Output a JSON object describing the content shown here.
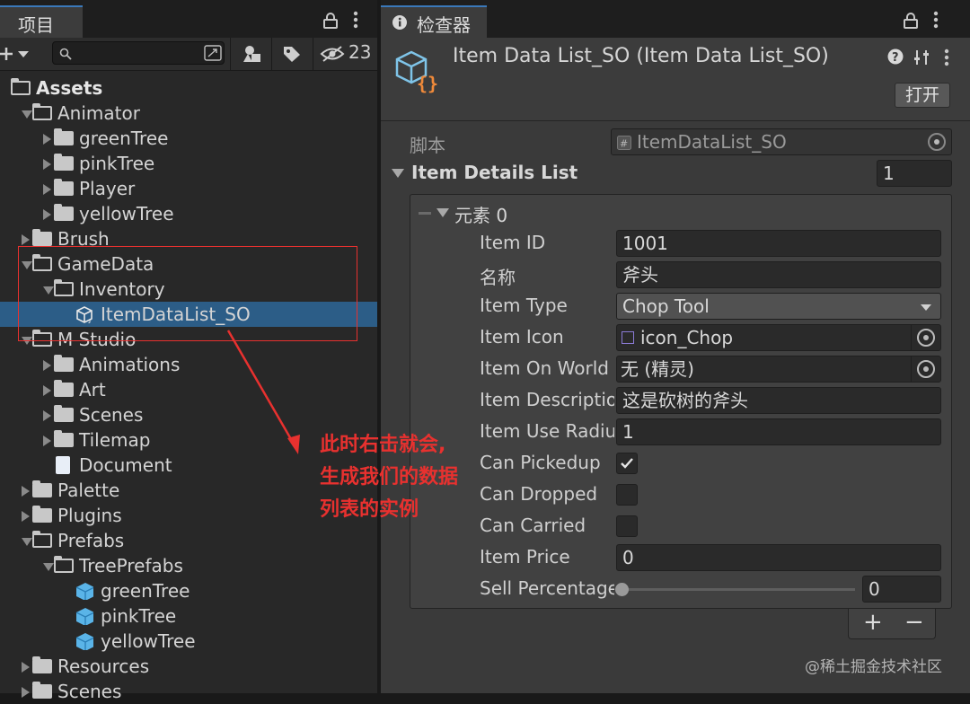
{
  "project_panel": {
    "tab_title": "项目",
    "search": {
      "value": "",
      "placeholder": ""
    },
    "hidden_count": "23",
    "assets_label": "Assets",
    "tree": [
      {
        "label": "Animator",
        "depth": 1,
        "expanded": true
      },
      {
        "label": "greenTree",
        "depth": 2,
        "expanded": false
      },
      {
        "label": "pinkTree",
        "depth": 2,
        "expanded": false
      },
      {
        "label": "Player",
        "depth": 2,
        "expanded": false
      },
      {
        "label": "yellowTree",
        "depth": 2,
        "expanded": false
      },
      {
        "label": "Brush",
        "depth": 1,
        "expanded": false
      },
      {
        "label": "GameData",
        "depth": 1,
        "expanded": true
      },
      {
        "label": "Inventory",
        "depth": 2,
        "expanded": true
      },
      {
        "label": "ItemDataList_SO",
        "depth": 3,
        "kind": "scriptable",
        "selected": true
      },
      {
        "label": "M Studio",
        "depth": 1,
        "expanded": true
      },
      {
        "label": "Animations",
        "depth": 2,
        "expanded": false
      },
      {
        "label": "Art",
        "depth": 2,
        "expanded": false
      },
      {
        "label": "Scenes",
        "depth": 2,
        "expanded": false
      },
      {
        "label": "Tilemap",
        "depth": 2,
        "expanded": false
      },
      {
        "label": "Document",
        "depth": 2,
        "kind": "document"
      },
      {
        "label": "Palette",
        "depth": 1,
        "expanded": false
      },
      {
        "label": "Plugins",
        "depth": 1,
        "expanded": false
      },
      {
        "label": "Prefabs",
        "depth": 1,
        "expanded": true
      },
      {
        "label": "TreePrefabs",
        "depth": 2,
        "expanded": true
      },
      {
        "label": "greenTree",
        "depth": 3,
        "kind": "prefab"
      },
      {
        "label": "pinkTree",
        "depth": 3,
        "kind": "prefab"
      },
      {
        "label": "yellowTree",
        "depth": 3,
        "kind": "prefab"
      },
      {
        "label": "Resources",
        "depth": 1,
        "expanded": false
      },
      {
        "label": "Scenes",
        "depth": 1,
        "expanded": false
      }
    ]
  },
  "inspector": {
    "tab_title": "检查器",
    "object_title": "Item Data List_SO (Item Data List_SO)",
    "open_button": "打开",
    "script_label": "脚本",
    "script_value": "ItemDataList_SO",
    "list_label": "Item Details List",
    "list_count": "1",
    "element_label": "元素 0",
    "fields": {
      "item_id": {
        "label": "Item ID",
        "value": "1001"
      },
      "name": {
        "label": "名称",
        "value": "斧头"
      },
      "item_type": {
        "label": "Item Type",
        "value": "Chop Tool"
      },
      "item_icon": {
        "label": "Item Icon",
        "value": "icon_Chop"
      },
      "item_on_world": {
        "label": "Item On World",
        "value": "无 (精灵)"
      },
      "item_description": {
        "label": "Item Description",
        "value": "这是砍树的斧头"
      },
      "item_use_radius": {
        "label": "Item Use Radius",
        "value": "1"
      },
      "can_pickedup": {
        "label": "Can Pickedup",
        "checked": true
      },
      "can_dropped": {
        "label": "Can Dropped",
        "checked": false
      },
      "can_carried": {
        "label": "Can Carried",
        "checked": false
      },
      "item_price": {
        "label": "Item Price",
        "value": "0"
      },
      "sell_percentage": {
        "label": "Sell Percentage",
        "value": "0",
        "level": 0
      }
    },
    "add_button": "+",
    "remove_button": "−"
  },
  "annotation": {
    "lines": [
      "此时右击就会,",
      "生成我们的数据",
      "列表的实例"
    ],
    "color": "#e8312f"
  },
  "watermark": "@稀土掘金技术社区",
  "colors": {
    "selection": "#2c5d87",
    "tab_accent": "#3a79bb"
  }
}
